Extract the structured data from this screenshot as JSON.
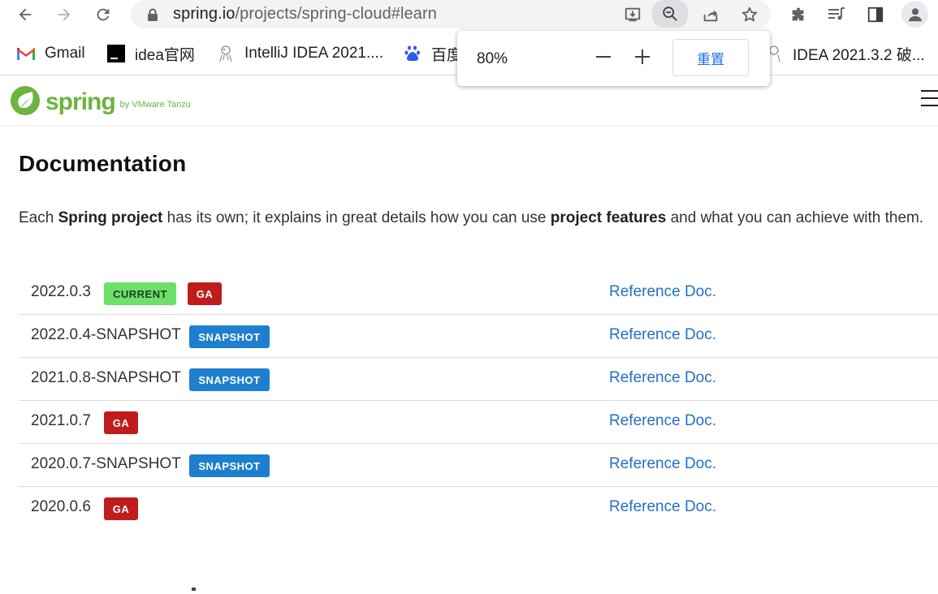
{
  "browser": {
    "url_main": "spring.io",
    "url_rest": "/projects/spring-cloud#learn",
    "icons": [
      "back-icon",
      "forward-icon",
      "reload-icon",
      "lock-icon",
      "install-icon",
      "zoom-icon",
      "share-icon",
      "star-icon",
      "extensions-icon",
      "media-icon",
      "side-panel-icon",
      "profile-icon"
    ]
  },
  "bookmarks": [
    {
      "label": "Gmail",
      "icon": "gmail-icon"
    },
    {
      "label": "idea官网",
      "icon": "idea-icon"
    },
    {
      "label": "IntelliJ IDEA 2021....",
      "icon": "intellij-icon"
    },
    {
      "label": "百度",
      "icon": "baidu-icon"
    },
    {
      "label": "IDEA 2021.3.2 破...",
      "icon": "idea-crack-icon"
    }
  ],
  "zoom_popup": {
    "level": "80%",
    "reset_label": "重置"
  },
  "site": {
    "logo_text": "spring",
    "logo_sub": "by VMware Tanzu"
  },
  "documentation": {
    "heading": "Documentation",
    "intro_1": "Each ",
    "intro_b1": "Spring project",
    "intro_2": " has its own; it explains in great details how you can use ",
    "intro_b2": "project features",
    "intro_3": " and what you can achieve with them.",
    "versions": [
      {
        "name": "2022.0.3",
        "badges": [
          "CURRENT",
          "GA"
        ],
        "link": "Reference Doc."
      },
      {
        "name": "2022.0.4-SNAPSHOT",
        "badges": [
          "SNAPSHOT"
        ],
        "link": "Reference Doc."
      },
      {
        "name": "2021.0.8-SNAPSHOT",
        "badges": [
          "SNAPSHOT"
        ],
        "link": "Reference Doc."
      },
      {
        "name": "2021.0.7",
        "badges": [
          "GA"
        ],
        "link": "Reference Doc."
      },
      {
        "name": "2020.0.7-SNAPSHOT",
        "badges": [
          "SNAPSHOT"
        ],
        "link": "Reference Doc."
      },
      {
        "name": "2020.0.6",
        "badges": [
          "GA"
        ],
        "link": "Reference Doc."
      }
    ]
  }
}
